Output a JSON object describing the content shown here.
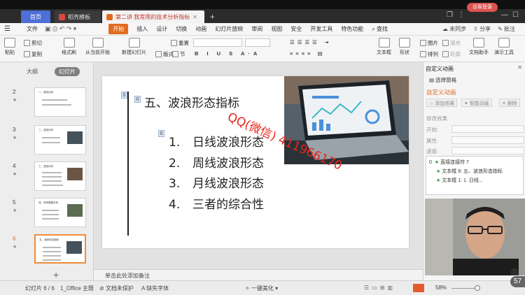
{
  "tabs": {
    "home": "首页",
    "template": "稻壳模板",
    "document": "第二讲 我常用的技术分析指标",
    "login": "访客登录"
  },
  "menu": {
    "file": "文件",
    "items": [
      "开始",
      "插入",
      "设计",
      "切换",
      "动画",
      "幻灯片放映",
      "审阅",
      "视图",
      "安全",
      "开发工具",
      "特色功能",
      "查找"
    ],
    "active_index": 0,
    "right": [
      "未同步",
      "分享",
      "批注"
    ]
  },
  "ribbon": {
    "paste": "粘贴",
    "cut": "剪切",
    "copy": "复制",
    "format_painter": "格式刷",
    "play_from_start": "从当前开始",
    "new_slide": "新建幻灯片",
    "layout": "版式",
    "section": "节",
    "reset": "重置",
    "picture": "图片",
    "fill": "填充",
    "textbox": "文本框",
    "shape": "形状",
    "arrange": "排列",
    "outline": "轮廓",
    "textbox_helper": "文档助手",
    "presentation_tools": "演示工具"
  },
  "left_panel": {
    "outline_tab": "大纲",
    "slides_tab": "幻灯片",
    "thumbs": [
      {
        "num": "2",
        "title": "一、准则分析"
      },
      {
        "num": "3",
        "title": "二、多因分析"
      },
      {
        "num": "4",
        "title": "三、多因分析"
      },
      {
        "num": "5",
        "title": "四、时间周期分析"
      },
      {
        "num": "6",
        "title": "五、波浪形态指标"
      }
    ]
  },
  "slide": {
    "title": "五、波浪形态指标",
    "title_tag": "0",
    "line_tag": "0",
    "list_tag": "0",
    "bullets": [
      {
        "num": "1.",
        "text": "日线波浪形态"
      },
      {
        "num": "2.",
        "text": "周线波浪形态"
      },
      {
        "num": "3.",
        "text": "月线波浪形态"
      },
      {
        "num": "4.",
        "text": "三者的综合性"
      }
    ],
    "watermark": "QQ(微信) 411966170"
  },
  "notes": "单击此处添加备注",
  "right_pane": {
    "title": "自定义动画",
    "select_pane": "选择窗格",
    "custom_anim": "自定义动画",
    "add_effect": "添加效果",
    "smart_anim": "智能动画",
    "delete": "删除",
    "modify": "修改效果",
    "start_label": "开始:",
    "property_label": "属性:",
    "speed_label": "速度:",
    "anim_list": [
      {
        "index": "0",
        "text": "直接连接符 7"
      },
      {
        "index": "",
        "text": "文本框 8: 五、波浪形态指标"
      },
      {
        "index": "",
        "text": "文本框 1: 1. 日线..."
      }
    ]
  },
  "status": {
    "slide_pos": "幻灯片 6 / 6",
    "theme": "1_Office 主题",
    "protect": "文档未保护",
    "missing_font": "缺失字体",
    "beautify": "一键美化",
    "zoom": "58%",
    "timer": "57"
  },
  "colors": {
    "accent": "#e26b1f",
    "home_tab": "#4d6fd6",
    "watermark": "#e8261c"
  }
}
